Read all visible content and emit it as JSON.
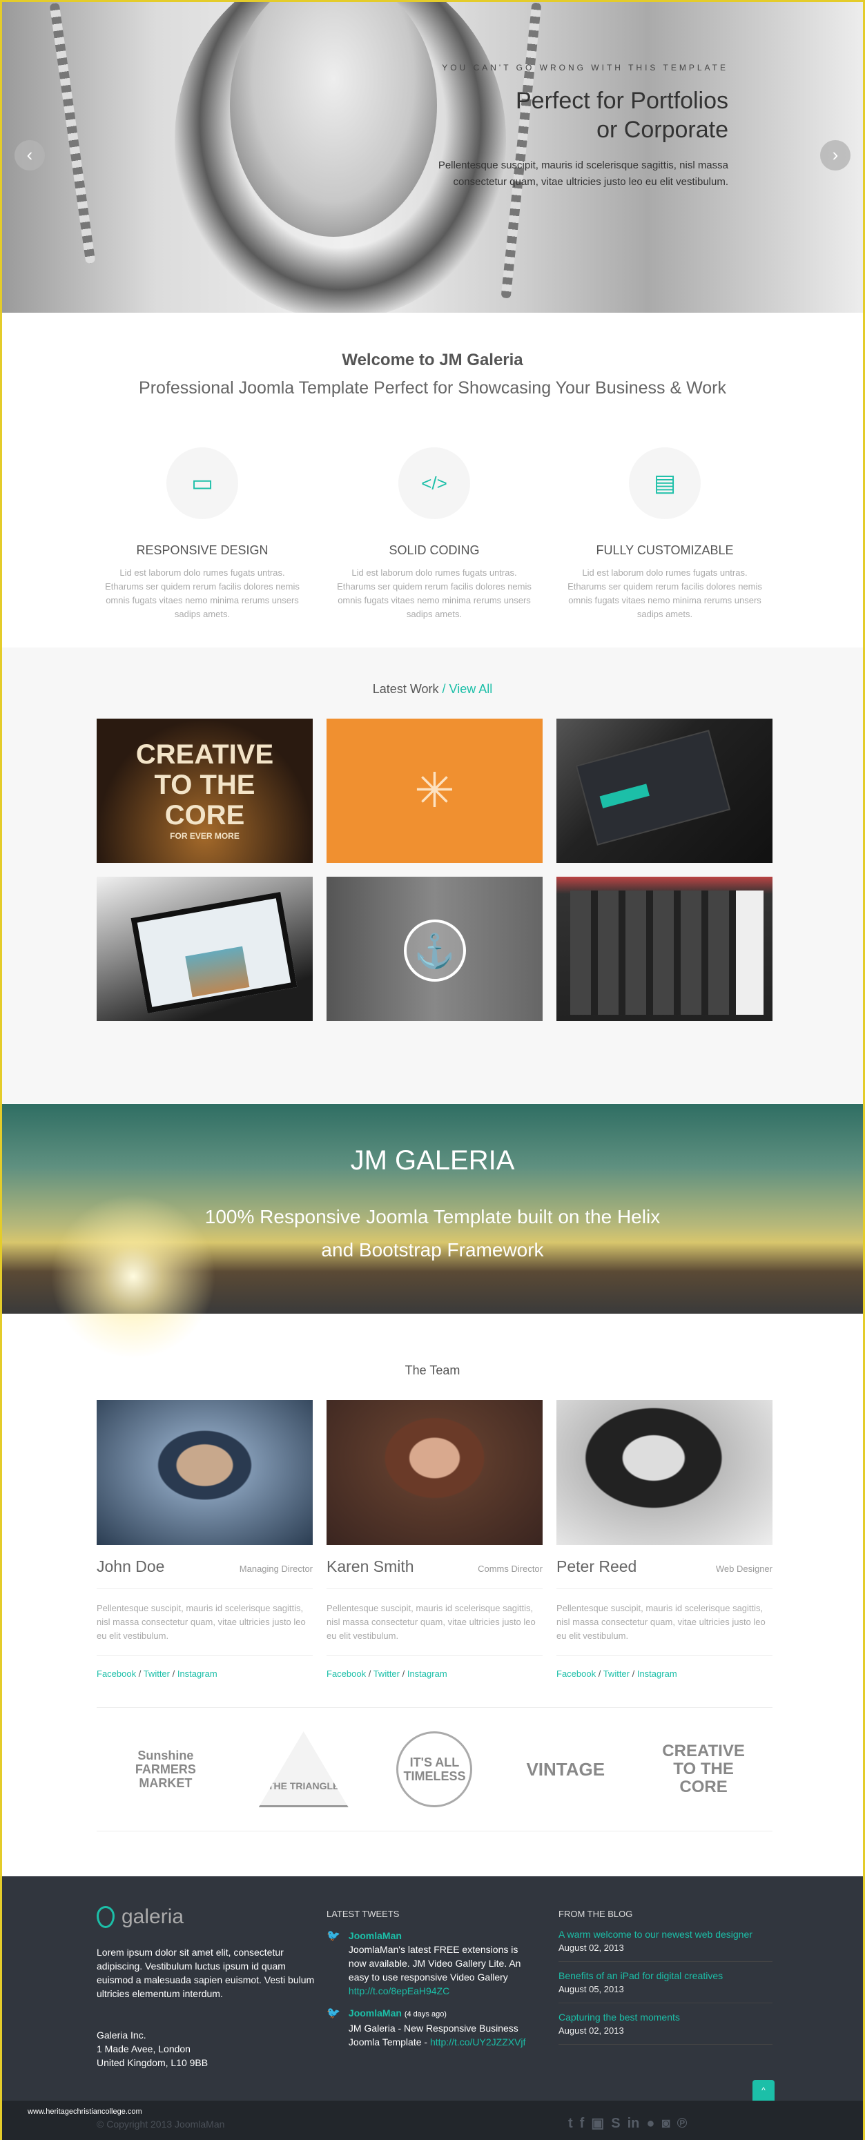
{
  "hero": {
    "kicker": "YOU CAN'T GO WRONG WITH THIS TEMPLATE",
    "title_line1": "Perfect for Portfolios",
    "title_line2": "or Corporate",
    "description": "Pellentesque suscipit, mauris id scelerisque sagittis, nisl massa consectetur quam, vitae ultricies justo leo eu elit vestibulum.",
    "prev": "‹",
    "next": "›"
  },
  "welcome": {
    "title": "Welcome to JM Galeria",
    "subtitle": "Professional Joomla Template Perfect for Showcasing Your Business & Work"
  },
  "features": [
    {
      "icon": "monitor-icon",
      "glyph": "▭",
      "title": "RESPONSIVE DESIGN",
      "text": "Lid est laborum dolo rumes fugats untras. Etharums ser quidem rerum facilis dolores nemis omnis fugats vitaes nemo minima rerums unsers sadips amets."
    },
    {
      "icon": "code-icon",
      "glyph": "</>",
      "title": "SOLID CODING",
      "text": "Lid est laborum dolo rumes fugats untras. Etharums ser quidem rerum facilis dolores nemis omnis fugats vitaes nemo minima rerums unsers sadips amets."
    },
    {
      "icon": "document-icon",
      "glyph": "▤",
      "title": "FULLY CUSTOMIZABLE",
      "text": "Lid est laborum dolo rumes fugats untras. Etharums ser quidem rerum facilis dolores nemis omnis fugats vitaes nemo minima rerums unsers sadips amets."
    }
  ],
  "work": {
    "title": "Latest Work",
    "view_all": "/ View All",
    "tiles": [
      {
        "label": "CREATIVE TO THE CORE",
        "sub": "FOR EVER MORE"
      },
      {
        "label": "✳"
      },
      {
        "label": ""
      },
      {
        "label": ""
      },
      {
        "label": "⚓"
      },
      {
        "label": ""
      }
    ]
  },
  "banner": {
    "title": "JM GALERIA",
    "line1": "100% Responsive Joomla Template built on the Helix",
    "line2": "and Bootstrap Framework"
  },
  "team": {
    "title": "The Team",
    "members": [
      {
        "name": "John Doe",
        "role": "Managing Director",
        "text": "Pellentesque suscipit, mauris id scelerisque sagittis, nisl massa consectetur quam, vitae ultricies justo leo eu elit vestibulum.",
        "facebook": "Facebook",
        "twitter": "Twitter",
        "instagram": "Instagram"
      },
      {
        "name": "Karen Smith",
        "role": "Comms Director",
        "text": "Pellentesque suscipit, mauris id scelerisque sagittis, nisl massa consectetur quam, vitae ultricies justo leo eu elit vestibulum.",
        "facebook": "Facebook",
        "twitter": "Twitter",
        "instagram": "Instagram"
      },
      {
        "name": "Peter Reed",
        "role": "Web Designer",
        "text": "Pellentesque suscipit, mauris id scelerisque sagittis, nisl massa consectetur quam, vitae ultricies justo leo eu elit vestibulum.",
        "facebook": "Facebook",
        "twitter": "Twitter",
        "instagram": "Instagram"
      }
    ]
  },
  "logos": [
    "Sunshine FARMERS MARKET",
    "THE TRIANGLE",
    "IT'S ALL TIMELESS",
    "VINTAGE",
    "CREATIVE TO THE CORE"
  ],
  "footer": {
    "brand": "galeria",
    "about": "Lorem ipsum dolor sit amet elit, consectetur adipiscing. Vestibulum luctus ipsum id quam euismod a malesuada sapien euismot. Vesti bulum ultricies elementum interdum.",
    "address": [
      "Galeria Inc.",
      "1 Made Avee, London",
      "United Kingdom, L10 9BB"
    ],
    "tweets_title": "LATEST TWEETS",
    "tweets": [
      {
        "user": "JoomlaMan",
        "ago": "",
        "text": "JoomlaMan's latest FREE extensions is now available. JM Video Gallery Lite. An easy to use responsive Video Gallery",
        "link": "http://t.co/8epEaH94ZC"
      },
      {
        "user": "JoomlaMan",
        "ago": "(4 days ago)",
        "text": "JM Galeria - New Responsive Business Joomla Template - ",
        "link": "http://t.co/UY2JZZXVjf"
      }
    ],
    "blog_title": "FROM THE BLOG",
    "blog": [
      {
        "title": "A warm welcome to our newest web designer",
        "date": "August 02, 2013"
      },
      {
        "title": "Benefits of an iPad for digital creatives",
        "date": "August 05, 2013"
      },
      {
        "title": "Capturing the best moments",
        "date": "August 02, 2013"
      }
    ],
    "to_top": "^",
    "watermark": "www.heritagechristiancollege.com",
    "copyright": "© Copyright 2013 JoomlaMan",
    "social": [
      "twitter",
      "facebook",
      "youtube",
      "skype",
      "linkedin",
      "flickr",
      "instagram",
      "pinterest"
    ]
  },
  "colors": {
    "accent": "#1cbfa8",
    "footer_bg": "#31363e",
    "bottom_bg": "#22262b"
  }
}
